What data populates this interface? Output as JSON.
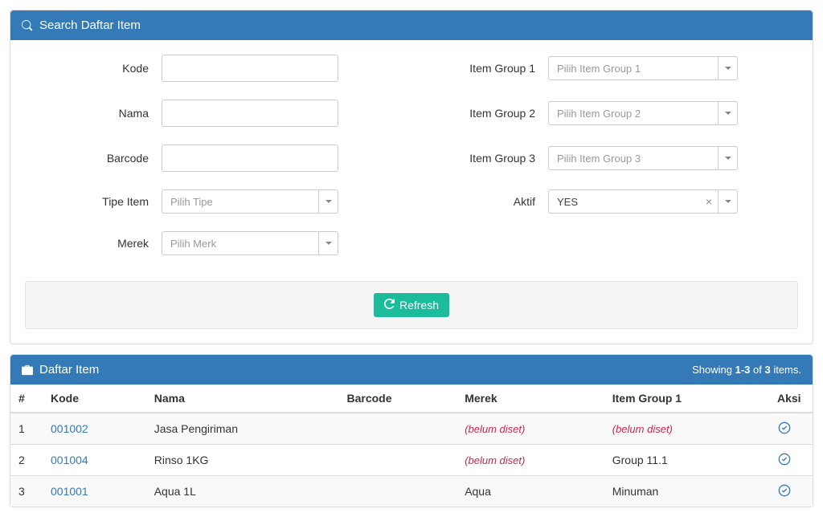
{
  "search_panel": {
    "title": "Search Daftar Item",
    "left": {
      "kode": {
        "label": "Kode",
        "value": ""
      },
      "nama": {
        "label": "Nama",
        "value": ""
      },
      "barcode": {
        "label": "Barcode",
        "value": ""
      },
      "tipe": {
        "label": "Tipe Item",
        "placeholder": "Pilih Tipe",
        "value": ""
      },
      "merek": {
        "label": "Merek",
        "placeholder": "Pilih Merk",
        "value": ""
      }
    },
    "right": {
      "group1": {
        "label": "Item Group 1",
        "placeholder": "Pilih Item Group 1",
        "value": ""
      },
      "group2": {
        "label": "Item Group 2",
        "placeholder": "Pilih Item Group 2",
        "value": ""
      },
      "group3": {
        "label": "Item Group 3",
        "placeholder": "Pilih Item Group 3",
        "value": ""
      },
      "aktif": {
        "label": "Aktif",
        "value": "YES"
      }
    },
    "refresh_label": "Refresh"
  },
  "list_panel": {
    "title": "Daftar Item",
    "summary_prefix": "Showing ",
    "summary_range": "1-3",
    "summary_mid": " of ",
    "summary_total": "3",
    "summary_suffix": " items.",
    "columns": {
      "num": "#",
      "kode": "Kode",
      "nama": "Nama",
      "barcode": "Barcode",
      "merek": "Merek",
      "group1": "Item Group 1",
      "aksi": "Aksi"
    },
    "not_set": "(belum diset)",
    "rows": [
      {
        "num": "1",
        "kode": "001002",
        "nama": "Jasa Pengiriman",
        "barcode": "",
        "merek": null,
        "group1": null
      },
      {
        "num": "2",
        "kode": "001004",
        "nama": "Rinso 1KG",
        "barcode": "",
        "merek": null,
        "group1": "Group 11.1"
      },
      {
        "num": "3",
        "kode": "001001",
        "nama": "Aqua 1L",
        "barcode": "",
        "merek": "Aqua",
        "group1": "Minuman"
      }
    ]
  }
}
